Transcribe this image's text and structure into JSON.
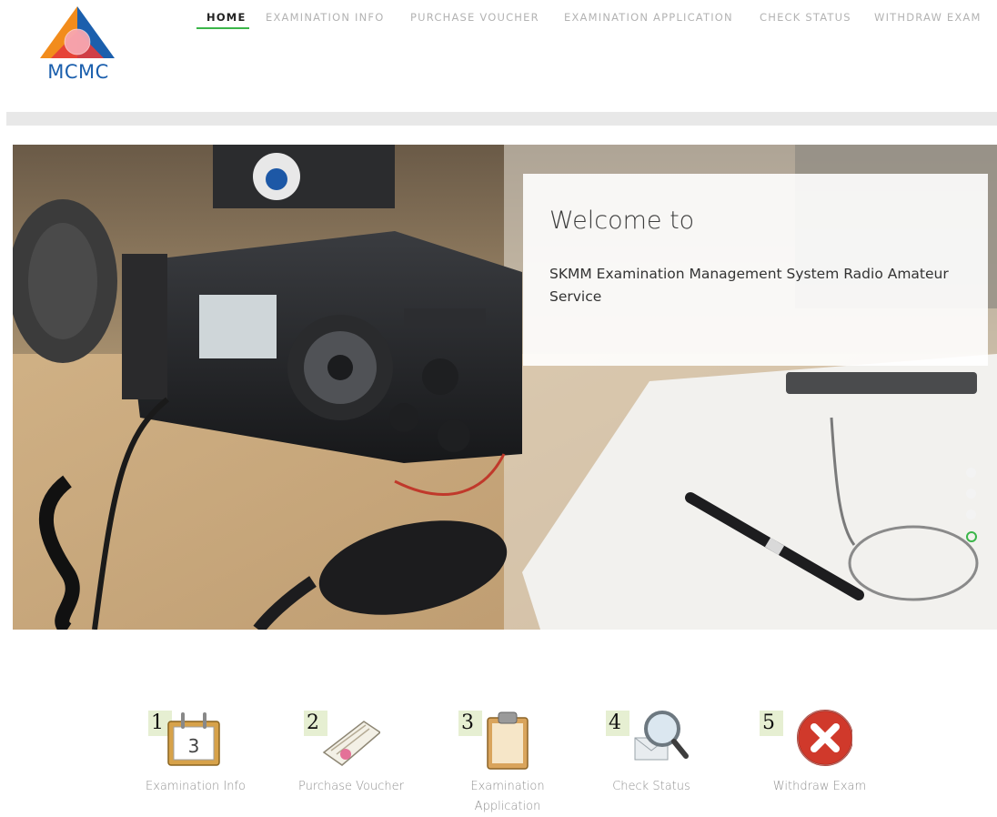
{
  "brand": {
    "logo_text": "MCMC"
  },
  "nav": {
    "items": [
      {
        "label": "HOME",
        "active": true
      },
      {
        "label": "EXAMINATION INFO",
        "active": false
      },
      {
        "label": "PURCHASE VOUCHER",
        "active": false
      },
      {
        "label": "EXAMINATION APPLICATION",
        "active": false
      },
      {
        "label": "CHECK STATUS",
        "active": false
      },
      {
        "label": "WITHDRAW EXAM",
        "active": false
      }
    ]
  },
  "hero": {
    "title": "Welcome to",
    "subtitle": "SKMM Examination Management System Radio Amateur Service",
    "slides_count": 4,
    "active_slide": 4
  },
  "features": [
    {
      "number": "1",
      "label": "Examination Info",
      "icon": "calendar-icon"
    },
    {
      "number": "2",
      "label": "Purchase Voucher",
      "icon": "voucher-icon"
    },
    {
      "number": "3",
      "label": "Examination Application",
      "icon": "clipboard-icon"
    },
    {
      "number": "4",
      "label": "Check Status",
      "icon": "magnifier-envelope-icon"
    },
    {
      "number": "5",
      "label": "Withdraw Exam",
      "icon": "red-x-icon"
    }
  ],
  "colors": {
    "accent": "#3bb64a",
    "nav_inactive": "#b3b3b3",
    "logo_orange": "#f28c1c",
    "logo_blue": "#1b5fad",
    "logo_red": "#e43b3b"
  }
}
